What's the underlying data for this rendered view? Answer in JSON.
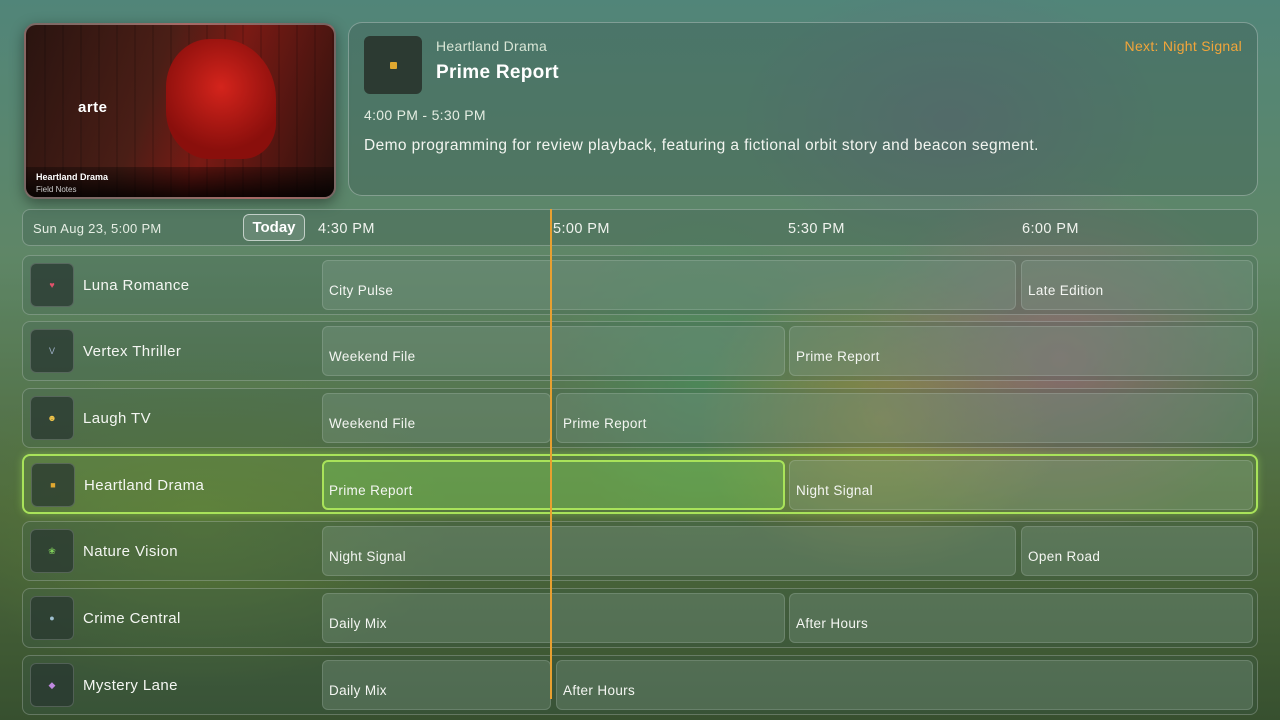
{
  "preview": {
    "channel": "Heartland Drama",
    "subtitle": "Field Notes",
    "watermark": "arte"
  },
  "info": {
    "channel": "Heartland Drama",
    "title": "Prime Report",
    "next": "Next: Night Signal",
    "time": "4:00 PM - 5:30 PM",
    "description": "Demo programming for review playback, featuring a fictional orbit story and beacon segment."
  },
  "timebar": {
    "date": "Sun Aug 23, 5:00 PM",
    "today": "Today",
    "ticks": [
      "4:30 PM",
      "5:00 PM",
      "5:30 PM",
      "6:00 PM"
    ]
  },
  "rows": [
    {
      "channel": "Luna Romance",
      "programs": [
        "City Pulse",
        "Late Edition"
      ]
    },
    {
      "channel": "Vertex Thriller",
      "programs": [
        "Weekend File",
        "Prime Report"
      ]
    },
    {
      "channel": "Laugh TV",
      "programs": [
        "Weekend File",
        "Prime Report"
      ]
    },
    {
      "channel": "Heartland Drama",
      "programs": [
        "Prime Report",
        "Night Signal"
      ]
    },
    {
      "channel": "Nature Vision",
      "programs": [
        "Night Signal",
        "Open Road"
      ]
    },
    {
      "channel": "Crime Central",
      "programs": [
        "Daily Mix",
        "After Hours"
      ]
    },
    {
      "channel": "Mystery Lane",
      "programs": [
        "Daily Mix",
        "After Hours"
      ]
    }
  ],
  "colors": {
    "accent": "#a9e35a",
    "now_line": "#e8a030",
    "next_label": "#f2a53a"
  }
}
